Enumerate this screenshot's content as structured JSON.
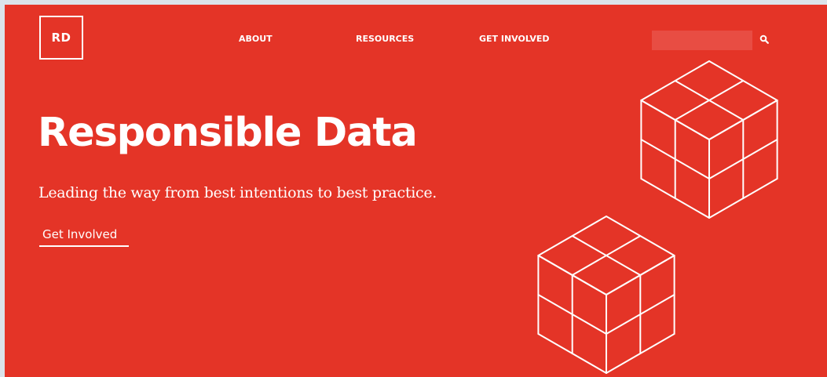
{
  "header": {
    "logo_text": "RD",
    "nav": [
      {
        "label": "ABOUT"
      },
      {
        "label": "RESOURCES"
      },
      {
        "label": "GET INVOLVED"
      }
    ],
    "search": {
      "placeholder": "",
      "value": ""
    }
  },
  "hero": {
    "title": "Responsible Data",
    "tagline": "Leading the way from best intentions to best practice.",
    "cta_label": "Get Involved"
  },
  "colors": {
    "brand_red": "#e43427",
    "text": "#ffffff",
    "page_border": "#dbe3ea"
  },
  "icons": {
    "search": "search-icon",
    "illustration": "isometric-cubes-illustration"
  }
}
